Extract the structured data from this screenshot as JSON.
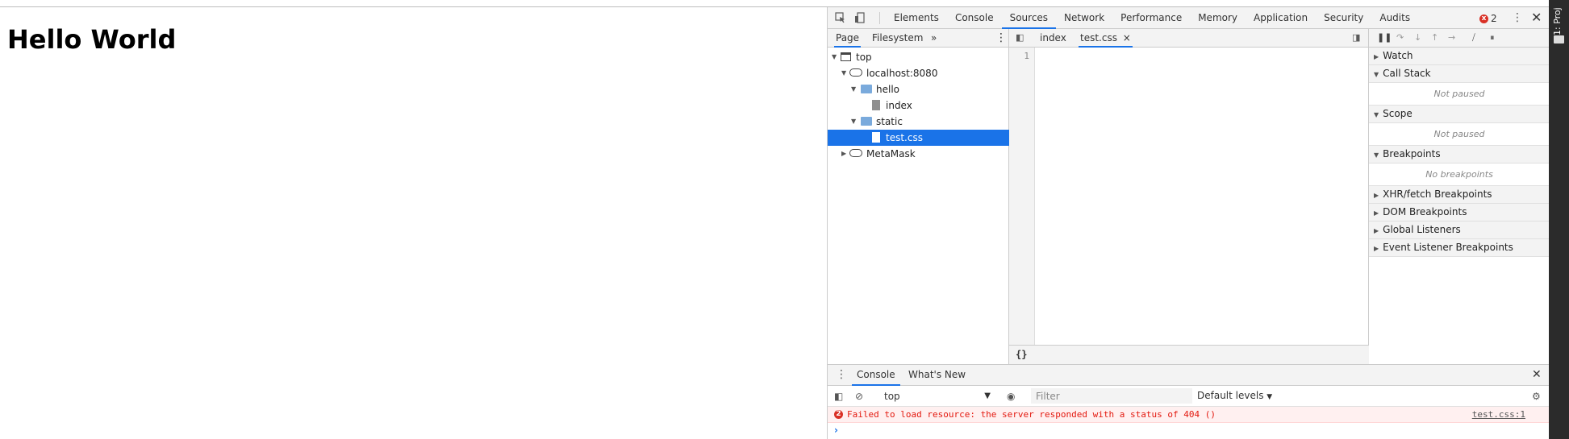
{
  "page": {
    "heading": "Hello World"
  },
  "side_strip": {
    "label": "1: Proj"
  },
  "toolbar": {
    "tabs": [
      "Elements",
      "Console",
      "Sources",
      "Network",
      "Performance",
      "Memory",
      "Application",
      "Security",
      "Audits"
    ],
    "active_tab": "Sources",
    "error_count": "2",
    "error_badge": "x"
  },
  "navigator": {
    "tabs": [
      "Page",
      "Filesystem"
    ],
    "more": "»",
    "tree": [
      {
        "label": "top",
        "type": "frame",
        "level": 0,
        "expanded": true
      },
      {
        "label": "localhost:8080",
        "type": "cloud",
        "level": 1,
        "expanded": true
      },
      {
        "label": "hello",
        "type": "folder",
        "level": 2,
        "expanded": true
      },
      {
        "label": "index",
        "type": "file",
        "level": 3
      },
      {
        "label": "static",
        "type": "folder",
        "level": 2,
        "expanded": true
      },
      {
        "label": "test.css",
        "type": "file",
        "level": 3,
        "selected": true
      },
      {
        "label": "MetaMask",
        "type": "cloud",
        "level": 1,
        "expanded": false
      }
    ]
  },
  "editor": {
    "tabs": [
      {
        "label": "index"
      },
      {
        "label": "test.css",
        "active": true,
        "close": "×"
      }
    ],
    "line_numbers": [
      "1"
    ],
    "pretty_print": "{}"
  },
  "debugger": {
    "panes": [
      {
        "title": "Watch",
        "expanded": false
      },
      {
        "title": "Call Stack",
        "expanded": true,
        "body": "Not paused"
      },
      {
        "title": "Scope",
        "expanded": true,
        "body": "Not paused"
      },
      {
        "title": "Breakpoints",
        "expanded": true,
        "body": "No breakpoints"
      },
      {
        "title": "XHR/fetch Breakpoints",
        "expanded": false
      },
      {
        "title": "DOM Breakpoints",
        "expanded": false
      },
      {
        "title": "Global Listeners",
        "expanded": false
      },
      {
        "title": "Event Listener Breakpoints",
        "expanded": false
      }
    ]
  },
  "console": {
    "tabs": [
      "Console",
      "What's New"
    ],
    "context": "top",
    "filter_placeholder": "Filter",
    "levels": "Default levels",
    "error": {
      "count": "2",
      "message": "Failed to load resource: the server responded with a status of 404 ()",
      "source": "test.css:1"
    },
    "prompt": "›"
  }
}
